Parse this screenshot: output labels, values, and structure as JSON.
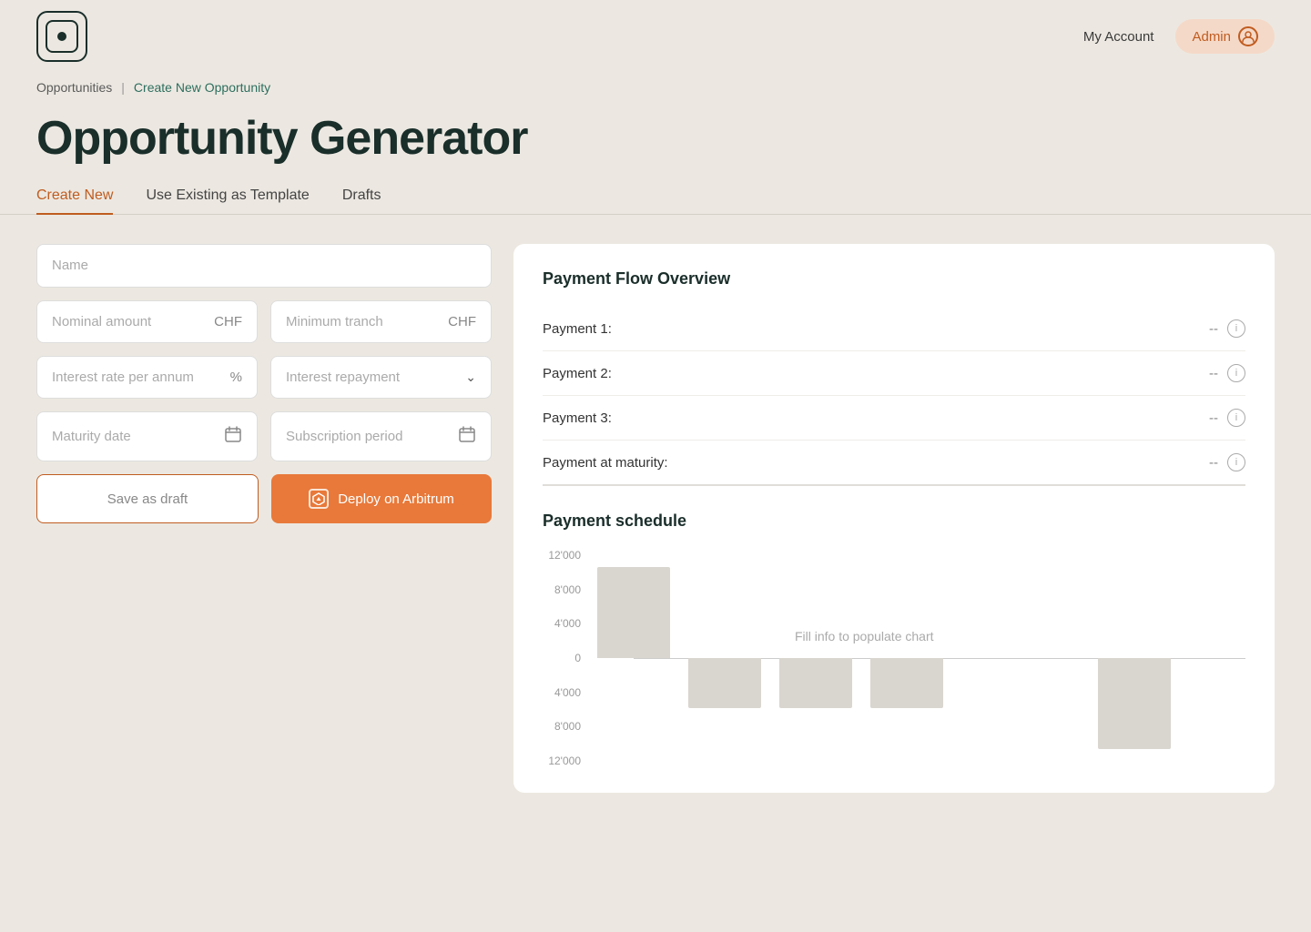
{
  "header": {
    "my_account_label": "My Account",
    "admin_label": "Admin"
  },
  "breadcrumb": {
    "opportunities": "Opportunities",
    "separator": "|",
    "create_new": "Create New Opportunity"
  },
  "page": {
    "title": "Opportunity Generator"
  },
  "tabs": [
    {
      "id": "create-new",
      "label": "Create New",
      "active": true
    },
    {
      "id": "use-existing",
      "label": "Use Existing as Template",
      "active": false
    },
    {
      "id": "drafts",
      "label": "Drafts",
      "active": false
    }
  ],
  "form": {
    "name_placeholder": "Name",
    "nominal_amount_placeholder": "Nominal amount",
    "nominal_amount_suffix": "CHF",
    "minimum_tranch_placeholder": "Minimum tranch",
    "minimum_tranch_suffix": "CHF",
    "interest_rate_placeholder": "Interest rate per annum",
    "interest_rate_suffix": "%",
    "interest_repayment_placeholder": "Interest repayment",
    "maturity_date_placeholder": "Maturity date",
    "subscription_period_placeholder": "Subscription period",
    "save_draft_label": "Save as draft",
    "deploy_label": "Deploy on Arbitrum"
  },
  "payment_flow": {
    "title": "Payment Flow Overview",
    "payments": [
      {
        "label": "Payment 1:",
        "value": "--"
      },
      {
        "label": "Payment 2:",
        "value": "--"
      },
      {
        "label": "Payment 3:",
        "value": "--"
      },
      {
        "label": "Payment at maturity:",
        "value": "--"
      }
    ]
  },
  "payment_schedule": {
    "title": "Payment schedule",
    "fill_label": "Fill info to populate chart",
    "y_labels": [
      "12'000",
      "8'000",
      "4'000",
      "0",
      "4'000",
      "8'000",
      "12'000"
    ]
  }
}
